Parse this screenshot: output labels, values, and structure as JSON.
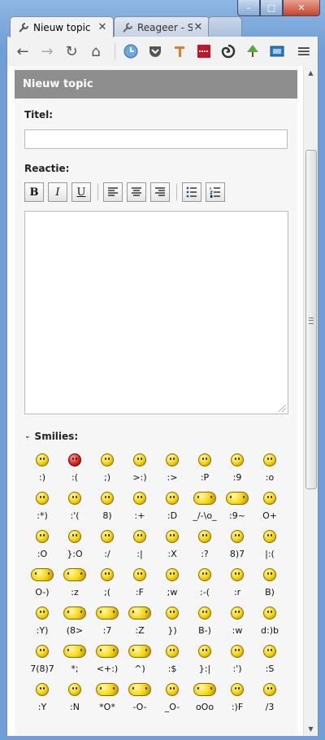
{
  "window": {
    "min": "–",
    "max": "□",
    "close": "✕"
  },
  "tabs": [
    {
      "title": "Nieuw topic",
      "close": "✕"
    },
    {
      "title": "Reageer - So",
      "close": "✕"
    }
  ],
  "toolbar": {
    "back": "←",
    "forward": "→",
    "reload": "↻",
    "home": "⌂",
    "menu": "≡"
  },
  "page": {
    "header": "Nieuw topic",
    "title_label": "Titel:",
    "title_value": "",
    "reply_label": "Reactie:",
    "editor_buttons": {
      "bold": "B",
      "italic": "I",
      "underline": "U"
    },
    "smilies_label": "Smilies:",
    "smilies_chevron": "⌄"
  },
  "smilies": [
    ":)",
    ":(",
    ";)",
    ">:)",
    ":>",
    ":P",
    ":9",
    ":o",
    ":*)",
    ":'(",
    "8)",
    ":+",
    ":D",
    "_/-\\o_",
    ":9~",
    "O+",
    ":O",
    "}:O",
    ":/",
    ":|",
    ":X",
    ":?",
    "8)7",
    "|:(",
    "O-)",
    ":z",
    ";(",
    ":F",
    ";w",
    ":-(",
    ":r",
    "B)",
    ":Y)",
    "(8>",
    ":7",
    ":Z",
    "})",
    "B-)",
    ":w",
    "d:)b",
    "7(8)7",
    "*;",
    "<+:)",
    "^)",
    ":$",
    "}:|",
    ":')",
    ":S",
    ":Y",
    ":N",
    "*O*",
    "-O-",
    "_O-",
    "oOo",
    ":)F",
    "/3"
  ],
  "colors": {
    "accent": "#8e8e8e",
    "frame": "#6f9fd6"
  }
}
